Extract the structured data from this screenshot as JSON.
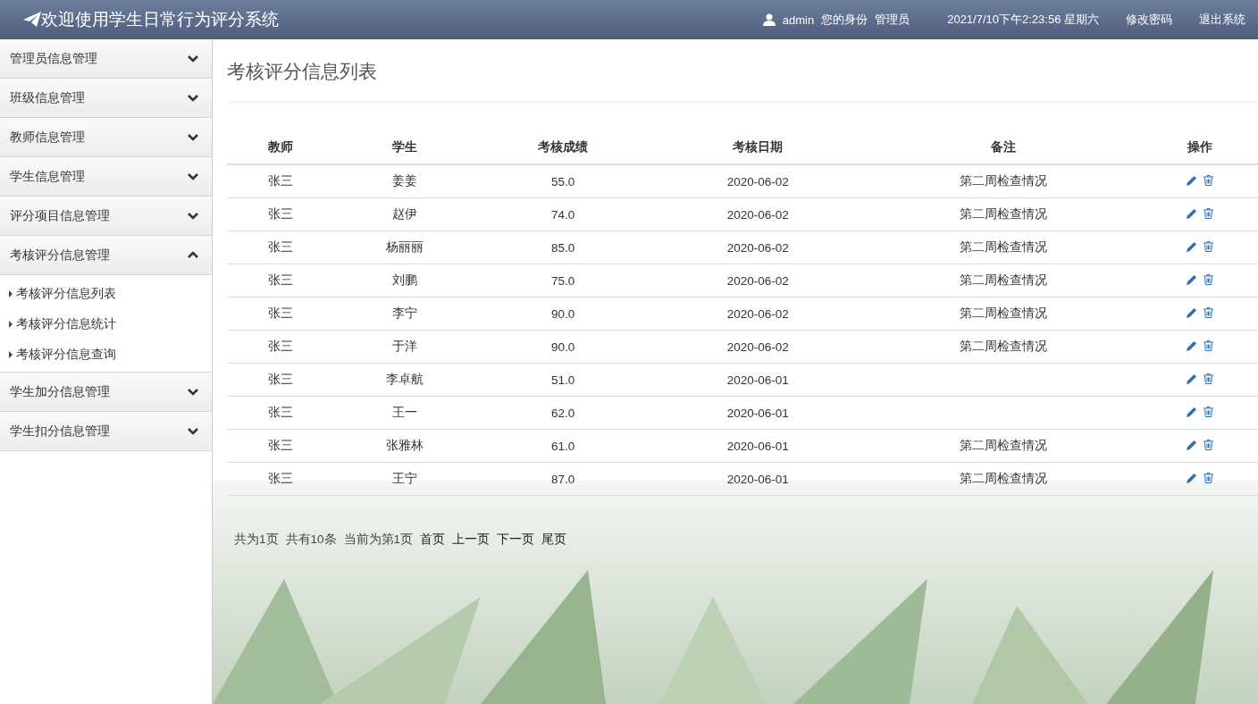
{
  "header": {
    "title": "欢迎使用学生日常行为评分系统",
    "user": "admin",
    "role_label": "您的身份",
    "role": "管理员",
    "datetime": "2021/7/10下午2:23:56 星期六",
    "links": [
      "修改密码",
      "退出系统"
    ]
  },
  "sidebar": {
    "groups": [
      {
        "label": "管理员信息管理",
        "expanded": false
      },
      {
        "label": "班级信息管理",
        "expanded": false
      },
      {
        "label": "教师信息管理",
        "expanded": false
      },
      {
        "label": "学生信息管理",
        "expanded": false
      },
      {
        "label": "评分项目信息管理",
        "expanded": false
      },
      {
        "label": "考核评分信息管理",
        "expanded": true,
        "items": [
          "考核评分信息列表",
          "考核评分信息统计",
          "考核评分信息查询"
        ]
      },
      {
        "label": "学生加分信息管理",
        "expanded": false
      },
      {
        "label": "学生扣分信息管理",
        "expanded": false
      }
    ]
  },
  "page_title": "考核评分信息列表",
  "table": {
    "columns": [
      "教师",
      "学生",
      "考核成绩",
      "考核日期",
      "备注",
      "操作"
    ],
    "rows": [
      {
        "teacher": "张三",
        "student": "姜姜",
        "score": "55.0",
        "date": "2020-06-02",
        "remark": "第二周检查情况"
      },
      {
        "teacher": "张三",
        "student": "赵伊",
        "score": "74.0",
        "date": "2020-06-02",
        "remark": "第二周检查情况"
      },
      {
        "teacher": "张三",
        "student": "杨丽丽",
        "score": "85.0",
        "date": "2020-06-02",
        "remark": "第二周检查情况"
      },
      {
        "teacher": "张三",
        "student": "刘鹏",
        "score": "75.0",
        "date": "2020-06-02",
        "remark": "第二周检查情况"
      },
      {
        "teacher": "张三",
        "student": "李宁",
        "score": "90.0",
        "date": "2020-06-02",
        "remark": "第二周检查情况"
      },
      {
        "teacher": "张三",
        "student": "于洋",
        "score": "90.0",
        "date": "2020-06-02",
        "remark": "第二周检查情况"
      },
      {
        "teacher": "张三",
        "student": "李卓航",
        "score": "51.0",
        "date": "2020-06-01"
      },
      {
        "teacher": "张三",
        "student": "王一",
        "score": "62.0",
        "date": "2020-06-01"
      },
      {
        "teacher": "张三",
        "student": "张雅林",
        "score": "61.0",
        "date": "2020-06-01",
        "remark": "第二周检查情况"
      },
      {
        "teacher": "张三",
        "student": "王宁",
        "score": "87.0",
        "date": "2020-06-01",
        "remark": "第二周检查情况"
      }
    ]
  },
  "pagination": [
    {
      "kind": "info",
      "text": "共为1页"
    },
    {
      "kind": "info",
      "text": "共有10条"
    },
    {
      "kind": "info",
      "text": "当前为第1页"
    },
    {
      "kind": "link",
      "text": "首页"
    },
    {
      "kind": "link",
      "text": "上一页"
    },
    {
      "kind": "link",
      "text": "下一页"
    },
    {
      "kind": "link",
      "text": "尾页"
    }
  ]
}
